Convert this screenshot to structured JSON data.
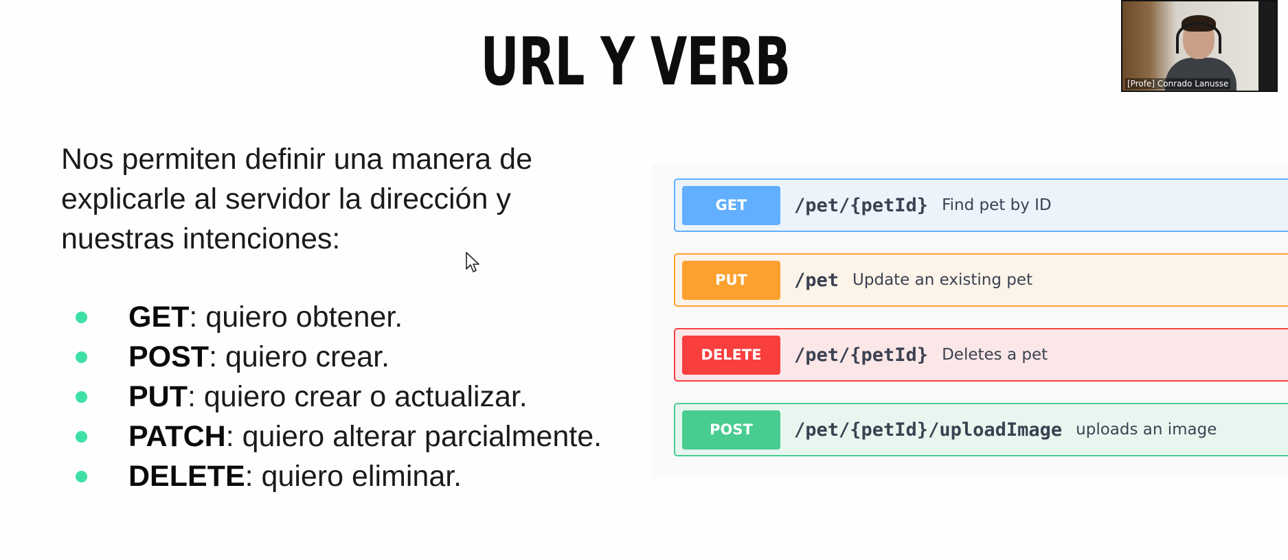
{
  "slide": {
    "title": "URL Y VERB",
    "intro": "Nos permiten definir una manera de explicarle al servidor la dirección y nuestras intenciones:",
    "bullets": [
      {
        "verb": "GET",
        "text": ": quiero obtener."
      },
      {
        "verb": "POST",
        "text": ": quiero crear."
      },
      {
        "verb": "PUT",
        "text": ": quiero crear o actualizar."
      },
      {
        "verb": "PATCH",
        "text": ": quiero alterar parcialmente."
      },
      {
        "verb": "DELETE",
        "text": ": quiero eliminar."
      }
    ],
    "bullet_color": "#3fe0a6"
  },
  "swagger": {
    "operations": [
      {
        "method": "GET",
        "path": "/pet/{petId}",
        "description": "Find pet by ID",
        "color": "#61affe"
      },
      {
        "method": "PUT",
        "path": "/pet",
        "description": "Update an existing pet",
        "color": "#fca130"
      },
      {
        "method": "DELETE",
        "path": "/pet/{petId}",
        "description": "Deletes a pet",
        "color": "#f93e3e"
      },
      {
        "method": "POST",
        "path": "/pet/{petId}/uploadImage",
        "description": "uploads an image",
        "color": "#49cc90"
      }
    ]
  },
  "video": {
    "participant_label": "[Profe] Conrado Lanusse"
  },
  "icons": {
    "cursor": "mouse-pointer-icon"
  }
}
